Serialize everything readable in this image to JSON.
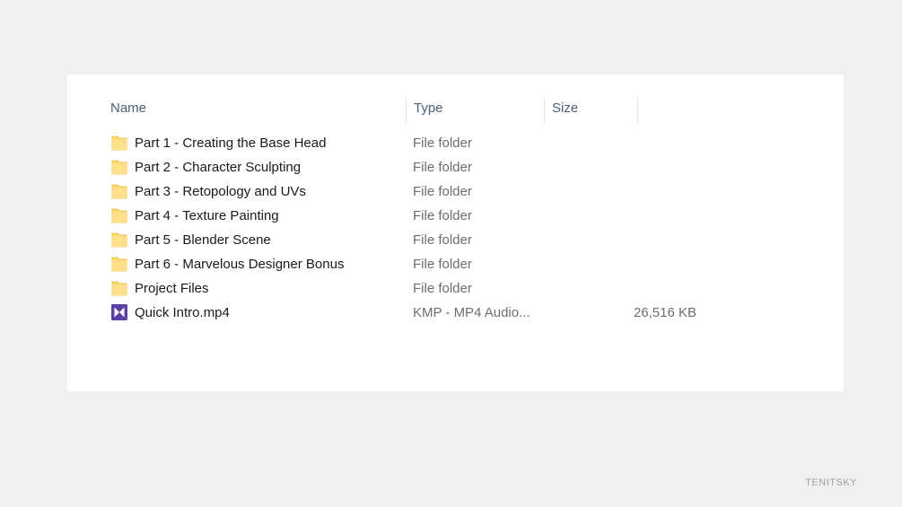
{
  "columns": {
    "name": "Name",
    "type": "Type",
    "size": "Size"
  },
  "files": [
    {
      "name": "Part 1 - Creating the Base Head",
      "type": "File folder",
      "size": "",
      "icon": "folder-icon"
    },
    {
      "name": "Part 2 - Character Sculpting",
      "type": "File folder",
      "size": "",
      "icon": "folder-icon"
    },
    {
      "name": "Part 3 - Retopology and UVs",
      "type": "File folder",
      "size": "",
      "icon": "folder-icon"
    },
    {
      "name": "Part 4 - Texture Painting",
      "type": "File folder",
      "size": "",
      "icon": "folder-icon"
    },
    {
      "name": "Part 5 - Blender Scene",
      "type": "File folder",
      "size": "",
      "icon": "folder-icon"
    },
    {
      "name": "Part 6 - Marvelous Designer Bonus",
      "type": "File folder",
      "size": "",
      "icon": "folder-icon"
    },
    {
      "name": "Project Files",
      "type": "File folder",
      "size": "",
      "icon": "folder-icon"
    },
    {
      "name": "Quick Intro.mp4",
      "type": "KMP - MP4 Audio...",
      "size": "26,516 KB",
      "icon": "video-file-icon"
    }
  ],
  "colors": {
    "folder": "#ffd766",
    "video": "#5b3fa6",
    "header_text": "#4c607a"
  },
  "watermark": "TENITSKY"
}
